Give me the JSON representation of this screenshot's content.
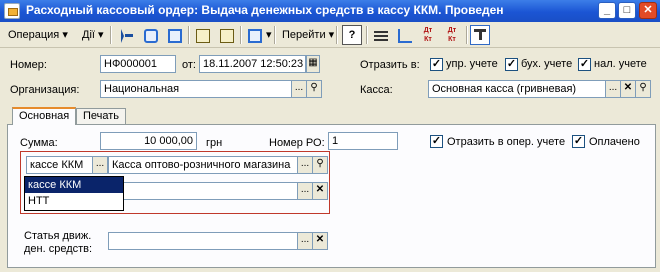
{
  "window": {
    "title": "Расходный кассовый ордер: Выдача денежных средств в кассу ККМ. Проведен",
    "controls": {
      "minimize": "_",
      "maximize": "□",
      "close": "✕"
    }
  },
  "toolbar": {
    "operation_label": "Операция",
    "actions_label": "Дії",
    "goto_label": "Перейти",
    "help_label": "?",
    "dt_kt_label_1": "Дт Кт",
    "dt_kt_label_2": "Дт Кт"
  },
  "header": {
    "number_label": "Номер:",
    "number_value": "НФ000001",
    "date_label": "от:",
    "date_value": "18.11.2007 12:50:23",
    "reflect_label": "Отразить в:",
    "mgmt_label": "упр. учете",
    "mgmt_checked": true,
    "acc_label": "бух. учете",
    "acc_checked": true,
    "tax_label": "нал. учете",
    "tax_checked": true,
    "org_label": "Организация:",
    "org_value": "Национальная",
    "cash_label": "Касса:",
    "cash_value": "Основная касса (гривневая)"
  },
  "tabs": [
    {
      "label": "Основная",
      "active": true
    },
    {
      "label": "Печать",
      "active": false
    }
  ],
  "main": {
    "sum_label": "Сумма:",
    "sum_value": "10 000,00",
    "currency": "грн",
    "po_label": "Номер РО:",
    "po_value": "1",
    "reflect_oper_label": "Отразить в опер. учете",
    "reflect_oper_checked": true,
    "paid_label": "Оплачено",
    "paid_checked": true,
    "type_value": "кассе ККМ",
    "register_value": "Касса оптово-розничного магазина",
    "type_options": [
      "кассе ККМ",
      "НТТ"
    ],
    "selected_option": "кассе ККМ",
    "movement_label_1": "Статья движ.",
    "movement_label_2": "ден. средств:",
    "movement_value": ""
  },
  "colors": {
    "title_bar": "#1b55d4",
    "highlight_box": "#c0392b",
    "selection": "#0a246a"
  }
}
